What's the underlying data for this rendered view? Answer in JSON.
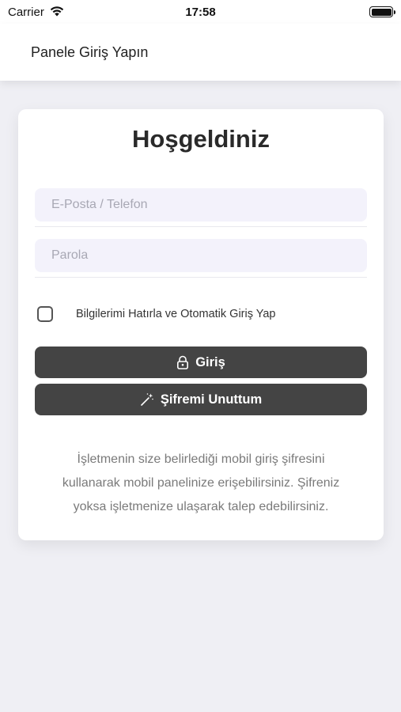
{
  "status_bar": {
    "carrier": "Carrier",
    "time": "17:58",
    "wifi_icon": "wifi-icon",
    "battery_icon": "battery-icon"
  },
  "nav": {
    "title": "Panele Giriş Yapın"
  },
  "login_card": {
    "title": "Hoşgeldiniz",
    "email_placeholder": "E-Posta / Telefon",
    "email_value": "",
    "password_placeholder": "Parola",
    "password_value": "",
    "remember_label": "Bilgilerimi Hatırla ve Otomatik Giriş Yap",
    "remember_checked": false,
    "login_button_label": "Giriş",
    "login_button_icon": "lock-icon",
    "forgot_button_label": "Şifremi Unuttum",
    "forgot_button_icon": "magic-wand-icon",
    "info_text": "İşletmenin size belirlediği mobil giriş şifresini kullanarak mobil panelinize erişebilirsiniz. Şifreniz yoksa işletmenize ulaşarak talep edebilirsiniz."
  },
  "colors": {
    "background": "#efeff4",
    "button": "#444444",
    "input_background": "#f3f2fb"
  }
}
